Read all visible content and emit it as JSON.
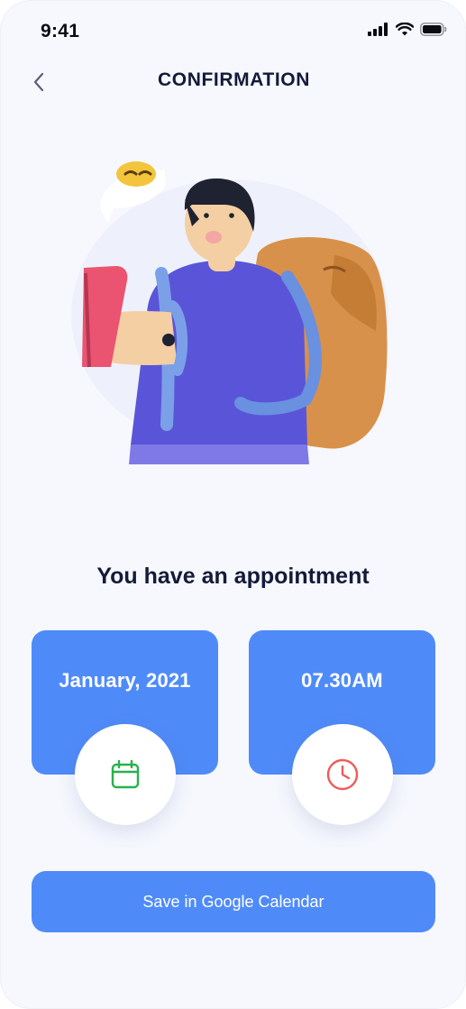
{
  "status_bar": {
    "time": "9:41"
  },
  "header": {
    "title": "CONFIRMATION"
  },
  "heading": "You have an appointment",
  "date_card": {
    "label": "January, 2021",
    "icon": "calendar-icon",
    "icon_color": "#27b24a"
  },
  "time_card": {
    "label": "07.30AM",
    "icon": "clock-icon",
    "icon_color": "#ef5a5a"
  },
  "save_button": {
    "label": "Save in Google Calendar"
  },
  "colors": {
    "accent": "#4f8bf8",
    "background": "#f6f8fe",
    "title": "#131a3a"
  }
}
